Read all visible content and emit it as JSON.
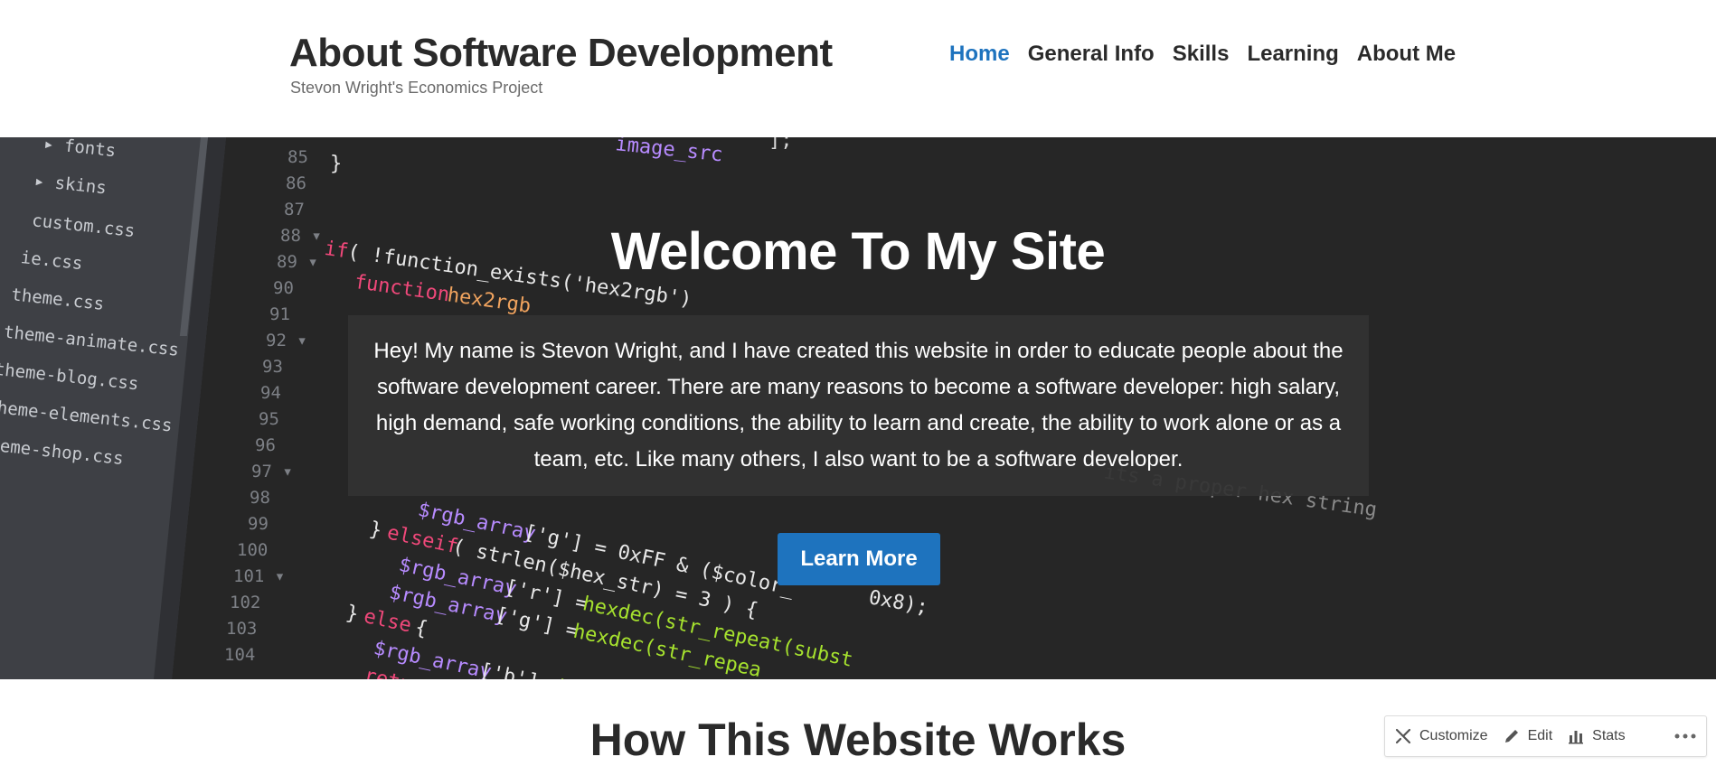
{
  "header": {
    "title": "About Software Development",
    "tagline": "Stevon Wright's Economics Project"
  },
  "nav": {
    "items": [
      {
        "label": "Home",
        "active": true
      },
      {
        "label": "General Info"
      },
      {
        "label": "Skills"
      },
      {
        "label": "Learning"
      },
      {
        "label": "About Me"
      }
    ]
  },
  "hero": {
    "title": "Welcome To My Site",
    "intro": "Hey! My name is Stevon Wright, and I have created this website in order to educate people about the software development career. There are many reasons to become a software developer: high salary, high demand, safe working conditions, the ability to learn and create, the ability to work alone or as a team, etc. Like many others, I also want to be a software developer.",
    "button_label": "Learn More",
    "background_icon": "code-editor-image"
  },
  "section": {
    "title": "How This Website Works"
  },
  "action_bar": {
    "customize_label": "Customize",
    "edit_label": "Edit",
    "stats_label": "Stats",
    "more_icon": "ellipsis-icon"
  },
  "colors": {
    "accent": "#1e73be",
    "hero_bg": "#262626",
    "text_dark": "#2a2a2a"
  }
}
